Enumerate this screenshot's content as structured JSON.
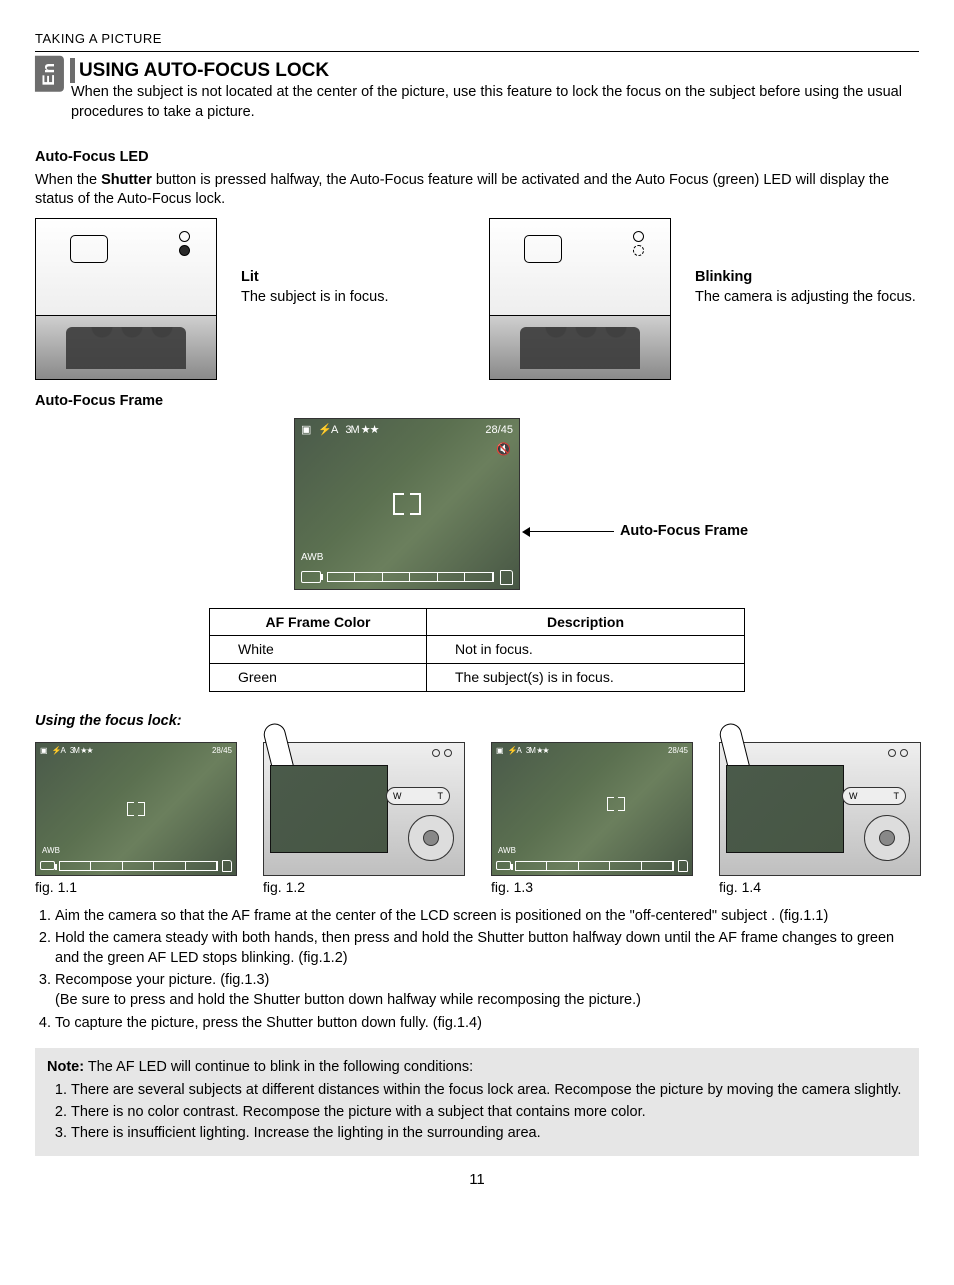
{
  "header": "TAKING A PICTURE",
  "langTab": "En",
  "title": "USING AUTO-FOCUS LOCK",
  "intro": "When the subject is not located at the center of the picture, use this feature to lock the focus on the subject before using the usual procedures to take a picture.",
  "led": {
    "heading": "Auto-Focus LED",
    "desc_prefix": "When the ",
    "desc_bold": "Shutter",
    "desc_suffix": " button is pressed halfway, the Auto-Focus feature will be activated and the Auto Focus (green) LED will display the status of the Auto-Focus lock.",
    "lit_title": "Lit",
    "lit_desc": "The subject is in focus.",
    "blink_title": "Blinking",
    "blink_desc": "The camera is adjusting the focus."
  },
  "frame": {
    "heading": "Auto-Focus Frame",
    "callout": "Auto-Focus Frame",
    "overlay": {
      "flash": "⚡A",
      "quality": "3M ★★",
      "count": "28/45",
      "awb": "AWB"
    },
    "tableHead": {
      "c1": "AF Frame Color",
      "c2": "Description"
    },
    "rows": [
      {
        "c1": "White",
        "c2": "Not in focus."
      },
      {
        "c1": "Green",
        "c2": "The subject(s) is in focus."
      }
    ]
  },
  "usingHeading": "Using the focus lock:",
  "figs": {
    "f1": "fig. 1.1",
    "f2": "fig. 1.2",
    "f3": "fig. 1.3",
    "f4": "fig. 1.4"
  },
  "wt": {
    "w": "W",
    "t": "T"
  },
  "steps": {
    "s1": "Aim the camera so that the AF frame at the center of the LCD screen is positioned on the \"off-centered\" subject . (fig.1.1)",
    "s2": "Hold the camera steady with both hands, then press and hold the Shutter button halfway down until the AF frame changes to green and the green AF LED stops blinking. (fig.1.2)",
    "s3a": "Recompose your picture. (fig.1.3)",
    "s3b": "(Be sure to press and hold the Shutter button down halfway while recomposing the picture.)",
    "s4": "To capture the picture, press the Shutter button down fully. (fig.1.4)"
  },
  "note": {
    "lead_bold": "Note:",
    "lead": " The AF LED will continue to blink in the following conditions:",
    "n1": "There are several subjects at different distances within the focus lock area. Recompose the picture by moving the camera slightly.",
    "n2": "There is no color contrast. Recompose the picture with a subject that contains more color.",
    "n3": "There is insufficient lighting. Increase the lighting in the surrounding area."
  },
  "pageNumber": "11"
}
